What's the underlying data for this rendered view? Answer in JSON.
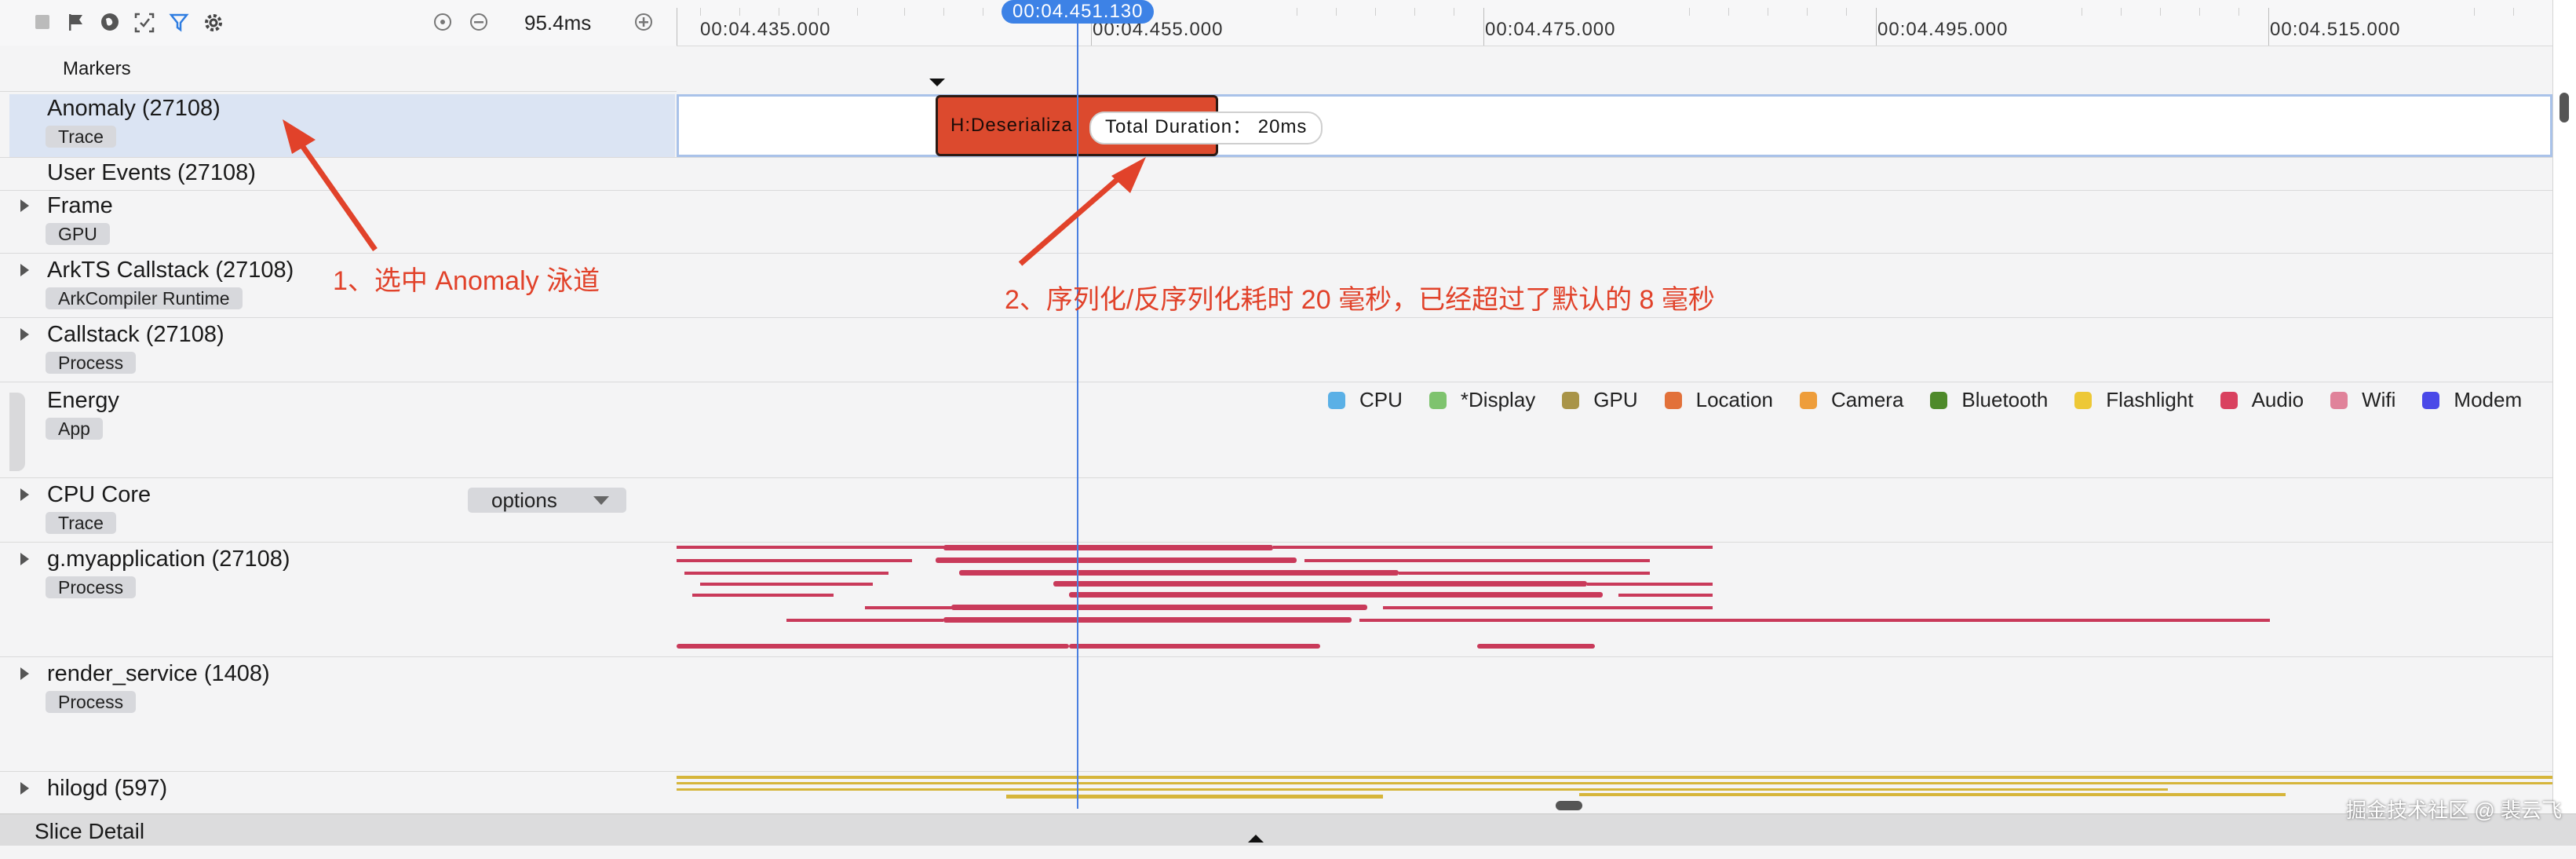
{
  "toolbar": {
    "zoom_value": "95.4ms",
    "icons": [
      "stop-icon",
      "flag-icon",
      "globe-icon",
      "capture-icon",
      "filter-icon",
      "settings-icon",
      "reset-zoom-icon",
      "zoom-out-icon",
      "zoom-in-icon"
    ]
  },
  "ruler": {
    "ticks": [
      "00:04.435.000",
      "00:04.455.000",
      "00:04.475.000",
      "00:04.495.000",
      "00:04.515.000"
    ],
    "cursor_time": "00:04.451.130"
  },
  "lanes": {
    "markers": {
      "title": "Markers"
    },
    "anomaly": {
      "title": "Anomaly (27108)",
      "tag": "Trace"
    },
    "user_events": {
      "title": "User Events (27108)"
    },
    "frame": {
      "title": "Frame",
      "tag": "GPU"
    },
    "arkts": {
      "title": "ArkTS Callstack (27108)",
      "tag": "ArkCompiler Runtime"
    },
    "callstack": {
      "title": "Callstack (27108)",
      "tag": "Process"
    },
    "energy": {
      "title": "Energy",
      "tag": "App"
    },
    "cpu_core": {
      "title": "CPU Core",
      "tag": "Trace",
      "options_label": "options"
    },
    "myapp": {
      "title": "g.myapplication (27108)",
      "tag": "Process"
    },
    "render": {
      "title": "render_service (1408)",
      "tag": "Process"
    },
    "hilogd": {
      "title": "hilogd (597)"
    }
  },
  "slice": {
    "label": "H:Deserializa",
    "tooltip": "Total Duration：  20ms",
    "color": "#dc4a2e"
  },
  "annotations": {
    "first": "1、选中 Anomaly 泳道",
    "second": "2、序列化/反序列化耗时 20 毫秒，已经超过了默认的 8 毫秒",
    "color": "#e1422a"
  },
  "energy_legend": [
    {
      "label": "CPU",
      "color": "#5ab0e6"
    },
    {
      "label": "*Display",
      "color": "#7ec36e"
    },
    {
      "label": "GPU",
      "color": "#a99448"
    },
    {
      "label": "Location",
      "color": "#e2713a"
    },
    {
      "label": "Camera",
      "color": "#ee9d3a"
    },
    {
      "label": "Bluetooth",
      "color": "#4e8a2a"
    },
    {
      "label": "Flashlight",
      "color": "#edc836"
    },
    {
      "label": "Audio",
      "color": "#d9415f"
    },
    {
      "label": "Wifi",
      "color": "#e0829a"
    },
    {
      "label": "Modem",
      "color": "#4a49e8"
    }
  ],
  "bottom": {
    "title": "Slice Detail"
  },
  "watermark": "掘金技术社区 @ 裴云飞"
}
